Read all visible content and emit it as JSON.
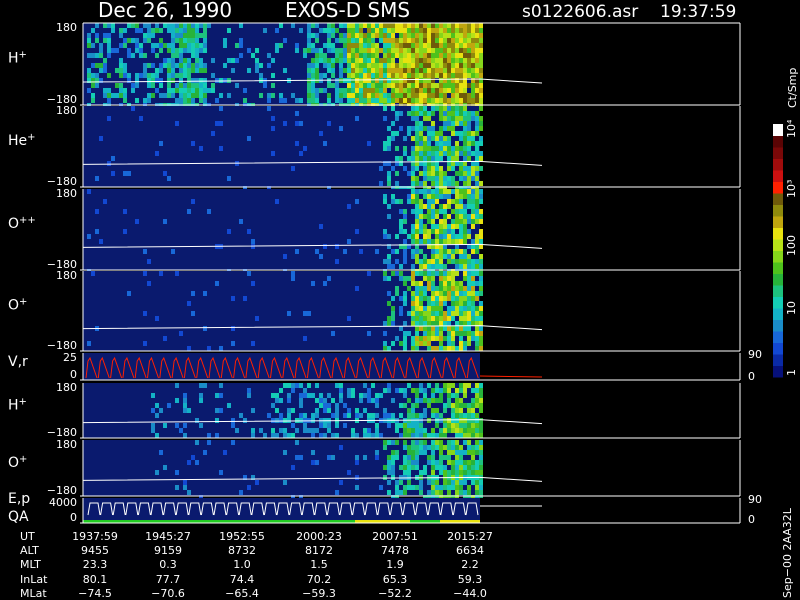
{
  "header": {
    "date": "Dec 26, 1990",
    "instrument": "EXOS-D SMS",
    "file": "s0122606.asr",
    "time": "19:37:59"
  },
  "colorbar": {
    "label": "Ct/Smp",
    "ticks": [
      "10⁴",
      "10³",
      "100",
      "10",
      "1"
    ],
    "colors": [
      "#06107a",
      "#0a2aa6",
      "#1248d2",
      "#1868d8",
      "#1a8cc8",
      "#13b2c6",
      "#14cdb5",
      "#1dc27e",
      "#27b33a",
      "#4ec21c",
      "#86d61a",
      "#b7e218",
      "#e8e20f",
      "#c0a60e",
      "#8f8a0c",
      "#6f5a0a",
      "#ff2000",
      "#cc1010",
      "#a00c0c",
      "#7a0808",
      "#5a0404",
      "#ffffff"
    ]
  },
  "panels": [
    {
      "id": "h-plus",
      "label": "H",
      "sup": "+",
      "ymax": "180",
      "ymin": "−180"
    },
    {
      "id": "he-plus",
      "label": "He",
      "sup": "+",
      "ymax": "180",
      "ymin": "−180"
    },
    {
      "id": "o-plusplus",
      "label": "O",
      "sup": "++",
      "ymax": "180",
      "ymin": "−180"
    },
    {
      "id": "o-plus",
      "label": "O",
      "sup": "+",
      "ymax": "180",
      "ymin": "−180"
    },
    {
      "id": "vr",
      "label": "V,r",
      "ymax": "25",
      "ymin": "0",
      "right_top": "90",
      "right_bottom": "0"
    },
    {
      "id": "h-plus-2",
      "label": "H",
      "sup": "+",
      "ymax": "180",
      "ymin": "−180"
    },
    {
      "id": "o-plus-2",
      "label": "O",
      "sup": "+",
      "ymax": "180",
      "ymin": "−180"
    },
    {
      "id": "ep-qa",
      "label": "E,p",
      "label2": "QA",
      "ymax": "4000",
      "ymin": "0",
      "right_top": "90",
      "right_bottom": "0"
    }
  ],
  "ephemeris": {
    "labels": [
      "UT",
      "ALT",
      "MLT",
      "InLat",
      "MLat"
    ],
    "columns": [
      [
        "1937:59",
        "9455",
        "23.3",
        "80.1",
        "−74.5"
      ],
      [
        "1945:27",
        "9159",
        "0.3",
        "77.7",
        "−70.6"
      ],
      [
        "1952:55",
        "8732",
        "1.0",
        "74.4",
        "−65.4"
      ],
      [
        "2000:23",
        "8172",
        "1.5",
        "70.2",
        "−59.3"
      ],
      [
        "2007:51",
        "7478",
        "1.9",
        "65.3",
        "−52.2"
      ],
      [
        "2015:27",
        "6634",
        "2.2",
        "59.3",
        "−44.0"
      ]
    ]
  },
  "footer_vertical": "Sep−00  2AA32L",
  "colors": {
    "background": "#000000",
    "panel_bg": "#0a1a6e",
    "trace": "#ffffff",
    "velocity_trace": "#ff2000"
  }
}
